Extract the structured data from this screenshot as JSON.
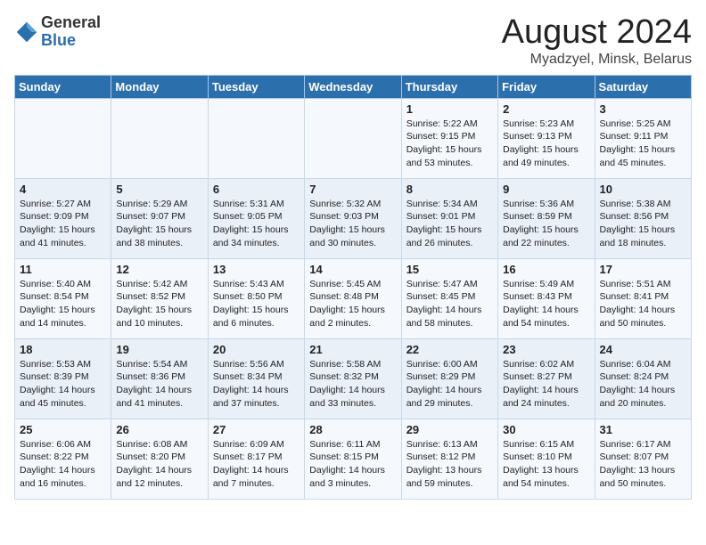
{
  "logo": {
    "general": "General",
    "blue": "Blue"
  },
  "title": "August 2024",
  "subtitle": "Myadzyel, Minsk, Belarus",
  "days_of_week": [
    "Sunday",
    "Monday",
    "Tuesday",
    "Wednesday",
    "Thursday",
    "Friday",
    "Saturday"
  ],
  "weeks": [
    [
      {
        "day": "",
        "info": ""
      },
      {
        "day": "",
        "info": ""
      },
      {
        "day": "",
        "info": ""
      },
      {
        "day": "",
        "info": ""
      },
      {
        "day": "1",
        "info": "Sunrise: 5:22 AM\nSunset: 9:15 PM\nDaylight: 15 hours\nand 53 minutes."
      },
      {
        "day": "2",
        "info": "Sunrise: 5:23 AM\nSunset: 9:13 PM\nDaylight: 15 hours\nand 49 minutes."
      },
      {
        "day": "3",
        "info": "Sunrise: 5:25 AM\nSunset: 9:11 PM\nDaylight: 15 hours\nand 45 minutes."
      }
    ],
    [
      {
        "day": "4",
        "info": "Sunrise: 5:27 AM\nSunset: 9:09 PM\nDaylight: 15 hours\nand 41 minutes."
      },
      {
        "day": "5",
        "info": "Sunrise: 5:29 AM\nSunset: 9:07 PM\nDaylight: 15 hours\nand 38 minutes."
      },
      {
        "day": "6",
        "info": "Sunrise: 5:31 AM\nSunset: 9:05 PM\nDaylight: 15 hours\nand 34 minutes."
      },
      {
        "day": "7",
        "info": "Sunrise: 5:32 AM\nSunset: 9:03 PM\nDaylight: 15 hours\nand 30 minutes."
      },
      {
        "day": "8",
        "info": "Sunrise: 5:34 AM\nSunset: 9:01 PM\nDaylight: 15 hours\nand 26 minutes."
      },
      {
        "day": "9",
        "info": "Sunrise: 5:36 AM\nSunset: 8:59 PM\nDaylight: 15 hours\nand 22 minutes."
      },
      {
        "day": "10",
        "info": "Sunrise: 5:38 AM\nSunset: 8:56 PM\nDaylight: 15 hours\nand 18 minutes."
      }
    ],
    [
      {
        "day": "11",
        "info": "Sunrise: 5:40 AM\nSunset: 8:54 PM\nDaylight: 15 hours\nand 14 minutes."
      },
      {
        "day": "12",
        "info": "Sunrise: 5:42 AM\nSunset: 8:52 PM\nDaylight: 15 hours\nand 10 minutes."
      },
      {
        "day": "13",
        "info": "Sunrise: 5:43 AM\nSunset: 8:50 PM\nDaylight: 15 hours\nand 6 minutes."
      },
      {
        "day": "14",
        "info": "Sunrise: 5:45 AM\nSunset: 8:48 PM\nDaylight: 15 hours\nand 2 minutes."
      },
      {
        "day": "15",
        "info": "Sunrise: 5:47 AM\nSunset: 8:45 PM\nDaylight: 14 hours\nand 58 minutes."
      },
      {
        "day": "16",
        "info": "Sunrise: 5:49 AM\nSunset: 8:43 PM\nDaylight: 14 hours\nand 54 minutes."
      },
      {
        "day": "17",
        "info": "Sunrise: 5:51 AM\nSunset: 8:41 PM\nDaylight: 14 hours\nand 50 minutes."
      }
    ],
    [
      {
        "day": "18",
        "info": "Sunrise: 5:53 AM\nSunset: 8:39 PM\nDaylight: 14 hours\nand 45 minutes."
      },
      {
        "day": "19",
        "info": "Sunrise: 5:54 AM\nSunset: 8:36 PM\nDaylight: 14 hours\nand 41 minutes."
      },
      {
        "day": "20",
        "info": "Sunrise: 5:56 AM\nSunset: 8:34 PM\nDaylight: 14 hours\nand 37 minutes."
      },
      {
        "day": "21",
        "info": "Sunrise: 5:58 AM\nSunset: 8:32 PM\nDaylight: 14 hours\nand 33 minutes."
      },
      {
        "day": "22",
        "info": "Sunrise: 6:00 AM\nSunset: 8:29 PM\nDaylight: 14 hours\nand 29 minutes."
      },
      {
        "day": "23",
        "info": "Sunrise: 6:02 AM\nSunset: 8:27 PM\nDaylight: 14 hours\nand 24 minutes."
      },
      {
        "day": "24",
        "info": "Sunrise: 6:04 AM\nSunset: 8:24 PM\nDaylight: 14 hours\nand 20 minutes."
      }
    ],
    [
      {
        "day": "25",
        "info": "Sunrise: 6:06 AM\nSunset: 8:22 PM\nDaylight: 14 hours\nand 16 minutes."
      },
      {
        "day": "26",
        "info": "Sunrise: 6:08 AM\nSunset: 8:20 PM\nDaylight: 14 hours\nand 12 minutes."
      },
      {
        "day": "27",
        "info": "Sunrise: 6:09 AM\nSunset: 8:17 PM\nDaylight: 14 hours\nand 7 minutes."
      },
      {
        "day": "28",
        "info": "Sunrise: 6:11 AM\nSunset: 8:15 PM\nDaylight: 14 hours\nand 3 minutes."
      },
      {
        "day": "29",
        "info": "Sunrise: 6:13 AM\nSunset: 8:12 PM\nDaylight: 13 hours\nand 59 minutes."
      },
      {
        "day": "30",
        "info": "Sunrise: 6:15 AM\nSunset: 8:10 PM\nDaylight: 13 hours\nand 54 minutes."
      },
      {
        "day": "31",
        "info": "Sunrise: 6:17 AM\nSunset: 8:07 PM\nDaylight: 13 hours\nand 50 minutes."
      }
    ]
  ]
}
